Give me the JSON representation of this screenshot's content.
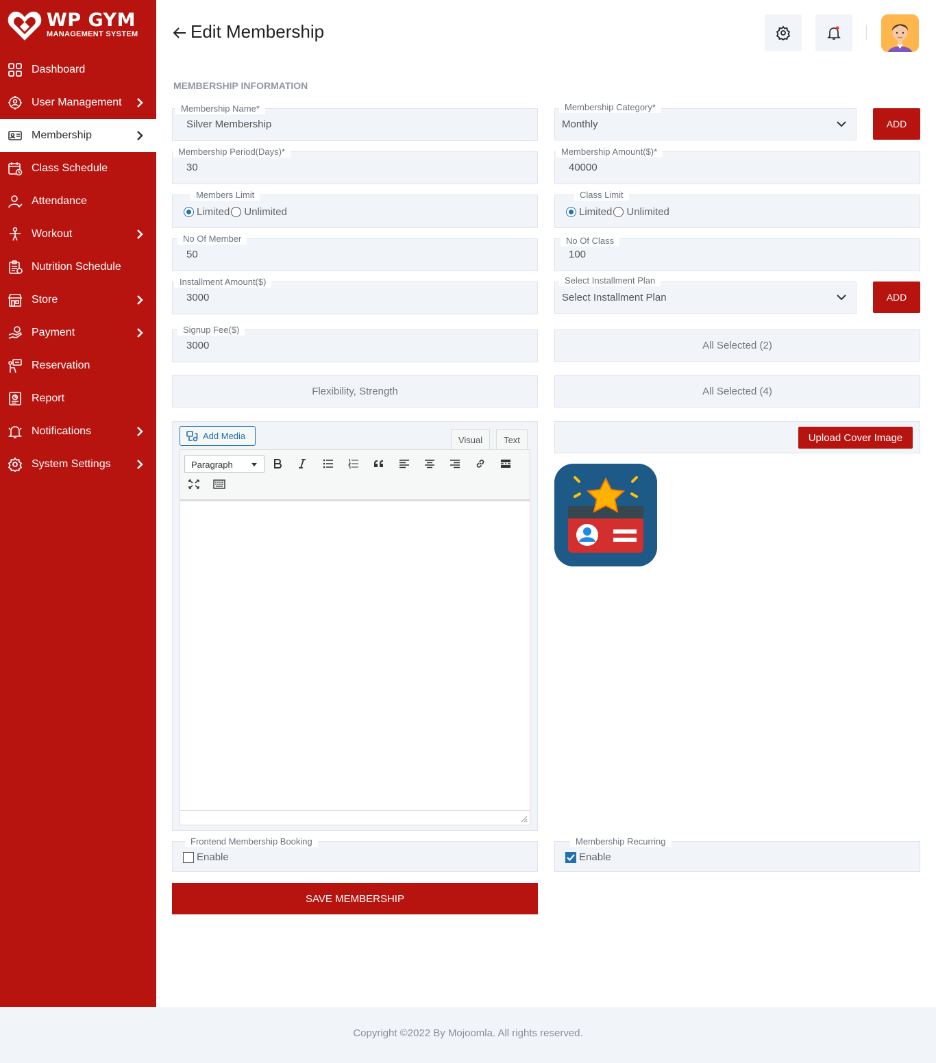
{
  "brand": {
    "title": "WP GYM",
    "subtitle": "MANAGEMENT SYSTEM",
    "accent": "#b8140f"
  },
  "sidebar": {
    "items": [
      {
        "label": "Dashboard",
        "icon": "dashboard-grid-icon",
        "has_submenu": false,
        "active": false
      },
      {
        "label": "User Management",
        "icon": "users-gear-icon",
        "has_submenu": true,
        "active": false
      },
      {
        "label": "Membership",
        "icon": "membership-card-icon",
        "has_submenu": true,
        "active": true
      },
      {
        "label": "Class Schedule",
        "icon": "calendar-icon",
        "has_submenu": false,
        "active": false
      },
      {
        "label": "Attendance",
        "icon": "user-check-icon",
        "has_submenu": false,
        "active": false
      },
      {
        "label": "Workout",
        "icon": "workout-icon",
        "has_submenu": true,
        "active": false
      },
      {
        "label": "Nutrition Schedule",
        "icon": "clipboard-icon",
        "has_submenu": false,
        "active": false
      },
      {
        "label": "Store",
        "icon": "store-icon",
        "has_submenu": true,
        "active": false
      },
      {
        "label": "Payment",
        "icon": "payment-hand-icon",
        "has_submenu": true,
        "active": false
      },
      {
        "label": "Reservation",
        "icon": "reservation-icon",
        "has_submenu": false,
        "active": false
      },
      {
        "label": "Report",
        "icon": "report-icon",
        "has_submenu": false,
        "active": false
      },
      {
        "label": "Notifications",
        "icon": "bell-icon",
        "has_submenu": true,
        "active": false
      },
      {
        "label": "System Settings",
        "icon": "gear-icon",
        "has_submenu": true,
        "active": false
      }
    ]
  },
  "header": {
    "title": "Edit Membership"
  },
  "form": {
    "section_title": "MEMBERSHIP INFORMATION",
    "membership_name": {
      "label": "Membership Name*",
      "value": "Silver Membership"
    },
    "membership_category": {
      "label": "Membership Category*",
      "value": "Monthly",
      "add_label": "ADD"
    },
    "membership_period": {
      "label": "Membership Period(Days)*",
      "value": "30"
    },
    "membership_amount": {
      "label": "Membership Amount($)*",
      "value": "40000"
    },
    "members_limit": {
      "label": "Members Limit",
      "option_limited": "Limited",
      "option_unlimited": "Unlimited",
      "selected": "Limited"
    },
    "class_limit": {
      "label": "Class Limit",
      "option_limited": "Limited",
      "option_unlimited": "Unlimited",
      "selected": "Limited"
    },
    "no_of_member": {
      "label": "No Of Member",
      "value": "50"
    },
    "no_of_class": {
      "label": "No Of Class",
      "value": "100"
    },
    "installment_amount": {
      "label": "Installment Amount($)",
      "value": "3000"
    },
    "installment_plan": {
      "label": "Select Installment Plan",
      "value": "Select Installment Plan",
      "add_label": "ADD"
    },
    "signup_fee": {
      "label": "Signup Fee($)",
      "value": "3000"
    },
    "multiselect_1": {
      "value": "All Selected (2)"
    },
    "multiselect_2": {
      "value": "Flexibility, Strength"
    },
    "multiselect_3": {
      "value": "All Selected (4)"
    },
    "editor": {
      "add_media_label": "Add Media",
      "tab_visual": "Visual",
      "tab_text": "Text",
      "format_value": "Paragraph"
    },
    "upload_cover_label": "Upload Cover Image",
    "frontend_booking": {
      "label": "Frontend Membership Booking",
      "option": "Enable",
      "checked": false
    },
    "membership_recurring": {
      "label": "Membership Recurring",
      "option": "Enable",
      "checked": true
    },
    "save_label": "SAVE MEMBERSHIP"
  },
  "footer": {
    "text": "Copyright ©2022 By Mojoomla. All rights reserved."
  }
}
